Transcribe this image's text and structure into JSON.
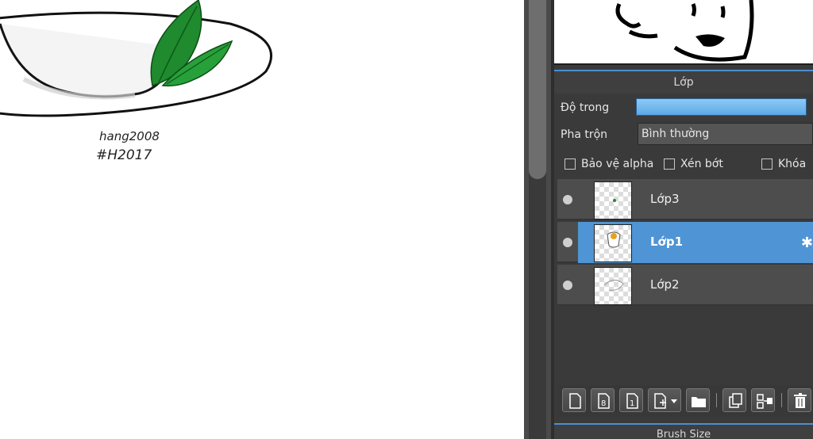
{
  "canvas": {
    "signature_line1": "hang2008",
    "signature_line2": "#H2017"
  },
  "layer_panel": {
    "title": "Lớp",
    "opacity_label": "Độ trong",
    "opacity_value_percent": 100,
    "blend_label": "Pha trộn",
    "blend_value": "Bình thường",
    "protect_alpha_label": "Bảo vệ alpha",
    "clipping_label": "Xén bớt",
    "lock_label": "Khóa",
    "layers": [
      {
        "name": "Lớp3",
        "visible": true,
        "selected": false
      },
      {
        "name": "Lớp1",
        "visible": true,
        "selected": true
      },
      {
        "name": "Lớp2",
        "visible": true,
        "selected": false
      }
    ],
    "toolbar": [
      "new-layer-icon",
      "new-8bit-layer-icon",
      "new-1bit-layer-icon",
      "add-layer-dropdown-icon",
      "folder-icon",
      "duplicate-layer-icon",
      "merge-layer-icon",
      "delete-layer-icon"
    ]
  },
  "brush_panel": {
    "title": "Brush Size"
  },
  "colors": {
    "selected_layer": "#4f94d4",
    "panel_bg": "#3a3a3a",
    "accent_line": "#4a8fd0",
    "leaf_green": "#1f8a2e"
  }
}
